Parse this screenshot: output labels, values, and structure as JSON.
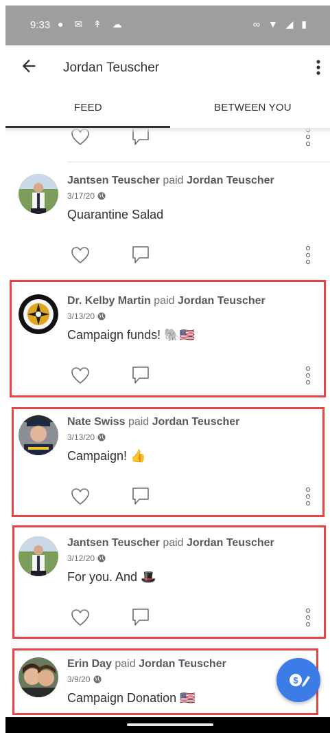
{
  "status_bar": {
    "time": "9:33"
  },
  "appbar": {
    "title": "Jordan Teuscher"
  },
  "tabs": [
    {
      "label": "FEED"
    },
    {
      "label": "BETWEEN YOU"
    }
  ],
  "feed": {
    "paid_word": "paid",
    "items": [
      {
        "payer": "Jantsen Teuscher",
        "payee": "Jordan Teuscher",
        "date": "3/17/20",
        "note": "Quarantine Salad"
      },
      {
        "payer": "Dr. Kelby Martin",
        "payee": "Jordan Teuscher",
        "date": "3/13/20",
        "note": "Campaign funds! 🐘🇺🇸"
      },
      {
        "payer": "Nate Swiss",
        "payee": "Jordan Teuscher",
        "date": "3/13/20",
        "note": "Campaign! 👍"
      },
      {
        "payer": "Jantsen Teuscher",
        "payee": "Jordan Teuscher",
        "date": "3/12/20",
        "note": "For you. And 🎩"
      },
      {
        "payer": "Erin Day",
        "payee": "Jordan Teuscher",
        "date": "3/9/20",
        "note": "Campaign Donation 🇺🇸"
      }
    ]
  },
  "colors": {
    "accent": "#3d7ce6",
    "highlight": "#e64545"
  }
}
